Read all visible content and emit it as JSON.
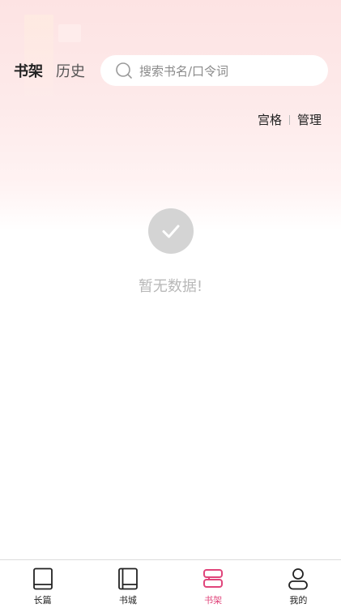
{
  "header": {
    "tabs": [
      {
        "label": "书架",
        "active": true
      },
      {
        "label": "历史",
        "active": false
      }
    ],
    "search": {
      "placeholder": "搜索书名/口令词",
      "icon": "search-icon"
    }
  },
  "toolbar": {
    "grid_label": "宫格",
    "manage_label": "管理"
  },
  "empty_state": {
    "icon": "check-icon",
    "message": "暂无数据!"
  },
  "bottom_nav": {
    "accent_color": "#e0457b",
    "items": [
      {
        "label": "长篇",
        "icon": "book-icon",
        "active": false
      },
      {
        "label": "书城",
        "icon": "book-store-icon",
        "active": false
      },
      {
        "label": "书架",
        "icon": "bookshelf-icon",
        "active": true
      },
      {
        "label": "我的",
        "icon": "profile-icon",
        "active": false
      }
    ]
  }
}
